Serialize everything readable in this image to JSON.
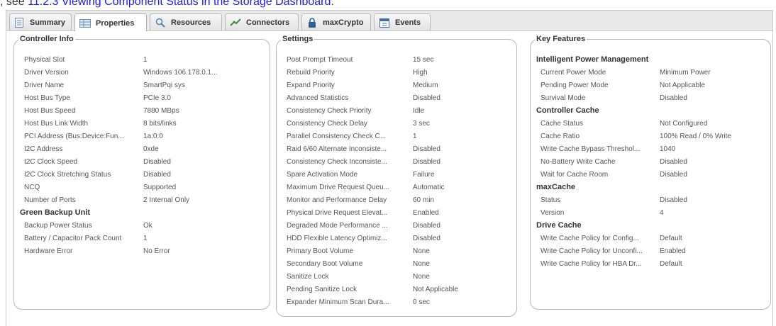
{
  "caption": {
    "lead": ", see ",
    "link": "11.2.3 Viewing Component Status in the Storage Dashboard."
  },
  "tabs": [
    {
      "label": "Summary",
      "icon": "document-icon"
    },
    {
      "label": "Properties",
      "icon": "properties-icon"
    },
    {
      "label": "Resources",
      "icon": "magnifier-icon"
    },
    {
      "label": "Connectors",
      "icon": "connector-icon"
    },
    {
      "label": "maxCrypto",
      "icon": "lock-icon"
    },
    {
      "label": "Events",
      "icon": "calendar-icon"
    }
  ],
  "active_tab": "Properties",
  "colors": {
    "caption_link": "#1a1aff",
    "tab_active_bg": "#ffffff",
    "panel_border": "#b8b8b8"
  },
  "controller_info": {
    "title": "Controller Info",
    "rows": [
      {
        "label": "Physical Slot",
        "value": "1"
      },
      {
        "label": "Driver Version",
        "value": "Windows 106.178.0.1..."
      },
      {
        "label": "Driver Name",
        "value": "SmartPqi sys"
      },
      {
        "label": "Host Bus Type",
        "value": "PCIe 3.0"
      },
      {
        "label": "Host Bus Speed",
        "value": "7880 MBps"
      },
      {
        "label": "Host Bus Link Width",
        "value": "8 bits/links"
      },
      {
        "label": "PCI Address (Bus:Device:Fun...",
        "value": "1a:0:0"
      },
      {
        "label": "I2C Address",
        "value": "0xde"
      },
      {
        "label": "I2C Clock Speed",
        "value": "Disabled"
      },
      {
        "label": "I2C Clock Stretching Status",
        "value": "Disabled"
      },
      {
        "label": "NCQ",
        "value": "Supported"
      },
      {
        "label": "Number of Ports",
        "value": "2 Internal Only"
      }
    ],
    "gbu_title": "Green Backup Unit",
    "gbu_rows": [
      {
        "label": "Backup Power Status",
        "value": "Ok"
      },
      {
        "label": "Battery / Capacitor Pack Count",
        "value": "1"
      },
      {
        "label": "Hardware Error",
        "value": "No Error"
      }
    ]
  },
  "settings": {
    "title": "Settings",
    "rows": [
      {
        "label": "Post Prompt Timeout",
        "value": "15 sec"
      },
      {
        "label": "Rebuild Priority",
        "value": "High"
      },
      {
        "label": "Expand Priority",
        "value": "Medium"
      },
      {
        "label": "Advanced Statistics",
        "value": "Disabled"
      },
      {
        "label": "Consistency Check Priority",
        "value": "Idle"
      },
      {
        "label": "Consistency Check Delay",
        "value": "3 sec"
      },
      {
        "label": "Parallel Consistency Check C...",
        "value": "1"
      },
      {
        "label": "Raid 6/60 Alternate Inconsiste...",
        "value": "Disabled"
      },
      {
        "label": "Consistency Check Inconsiste...",
        "value": "Disabled"
      },
      {
        "label": "Spare Activation Mode",
        "value": "Failure"
      },
      {
        "label": "Maximum Drive Request Queu...",
        "value": "Automatic"
      },
      {
        "label": "Monitor and Performance Delay",
        "value": "60 min"
      },
      {
        "label": "Physical Drive Request Elevat...",
        "value": "Enabled"
      },
      {
        "label": "Degraded Mode Performance ...",
        "value": "Disabled"
      },
      {
        "label": "HDD Flexible Latency Optimiz...",
        "value": "Disabled"
      },
      {
        "label": "Primary Boot Volume",
        "value": "None"
      },
      {
        "label": "Secondary Boot Volume",
        "value": "None"
      },
      {
        "label": "Sanitize Lock",
        "value": "None"
      },
      {
        "label": "Pending Sanitize Lock",
        "value": "Not Applicable"
      },
      {
        "label": "Expander Minimum Scan Dura...",
        "value": "0 sec"
      }
    ]
  },
  "key_features": {
    "title": "Key Features",
    "sections": [
      {
        "title": "Intelligent Power Management",
        "rows": [
          {
            "label": "Current Power Mode",
            "value": "Minimum Power"
          },
          {
            "label": "Pending Power Mode",
            "value": "Not Applicable"
          },
          {
            "label": "Survival Mode",
            "value": "Disabled"
          }
        ]
      },
      {
        "title": "Controller Cache",
        "rows": [
          {
            "label": "Cache Status",
            "value": "Not Configured"
          },
          {
            "label": "Cache Ratio",
            "value": "100% Read / 0% Write"
          },
          {
            "label": "Write Cache Bypass Threshol...",
            "value": "1040"
          },
          {
            "label": "No-Battery Write Cache",
            "value": "Disabled"
          },
          {
            "label": "Wait for Cache Room",
            "value": "Disabled"
          }
        ]
      },
      {
        "title": "maxCache",
        "rows": [
          {
            "label": "Status",
            "value": "Disabled"
          },
          {
            "label": "Version",
            "value": "4"
          }
        ]
      },
      {
        "title": "Drive Cache",
        "rows": [
          {
            "label": "Write Cache Policy for Config...",
            "value": "Default"
          },
          {
            "label": "Write Cache Policy for Unconfi...",
            "value": "Enabled"
          },
          {
            "label": "Write Cache Policy for HBA Dr...",
            "value": "Default"
          }
        ]
      }
    ]
  }
}
